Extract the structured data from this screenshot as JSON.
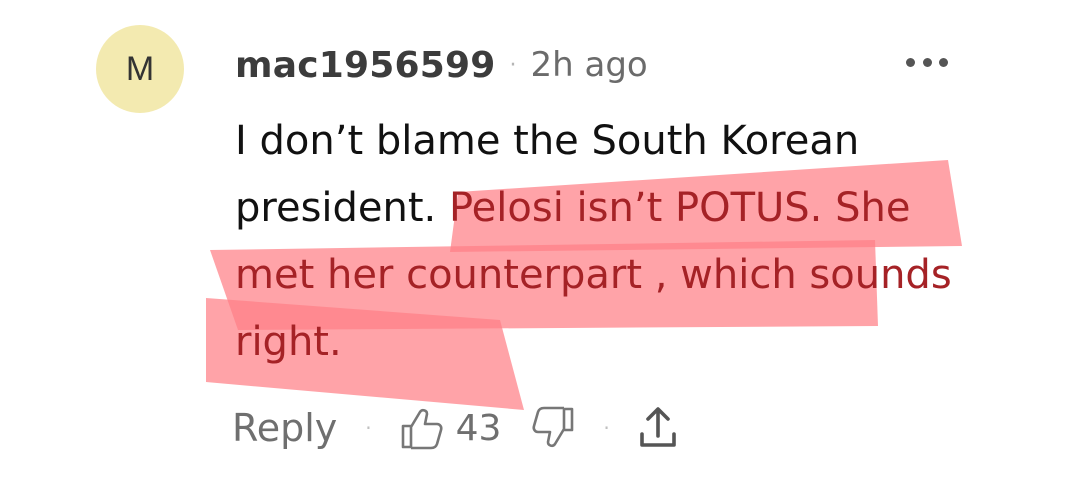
{
  "comment": {
    "avatar_letter": "M",
    "username": "mac1956599",
    "separator": "·",
    "timestamp": "2h ago",
    "text_plain": "I don’t blame the South Korean president. ",
    "text_highlighted": "Pelosi isn’t POTUS. She met her counterpart , which sounds right.",
    "highlight_color": "#ff7f86",
    "highlight_text_color": "#a52226"
  },
  "actions": {
    "reply_label": "Reply",
    "separator": "·",
    "like_count": "43",
    "icons": [
      "thumbs-up-icon",
      "thumbs-down-icon",
      "share-icon",
      "more-options-icon"
    ]
  }
}
